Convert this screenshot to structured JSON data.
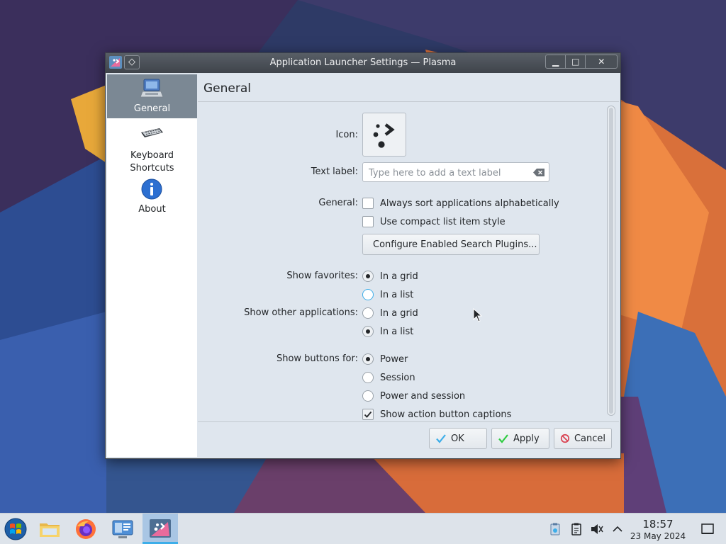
{
  "window": {
    "title": "Application Launcher Settings — Plasma",
    "pin_glyph": "◇",
    "minimize_glyph": "▁",
    "maximize_glyph": "□",
    "close_glyph": "✕"
  },
  "sidebar": {
    "items": [
      {
        "label": "General",
        "icon": "general-settings-icon",
        "active": true
      },
      {
        "label": "Keyboard\nShortcuts",
        "label_line1": "Keyboard",
        "label_line2": "Shortcuts",
        "icon": "keyboard-icon",
        "active": false
      },
      {
        "label": "About",
        "icon": "info-icon",
        "active": false
      }
    ]
  },
  "page": {
    "title": "General",
    "icon_label": "Icon:",
    "text_label": {
      "label": "Text label:",
      "value": "",
      "placeholder": "Type here to add a text label"
    },
    "general_label": "General:",
    "always_sort": {
      "label": "Always sort applications alphabetically",
      "checked": false
    },
    "compact_list": {
      "label": "Use compact list item style",
      "checked": false
    },
    "configure_plugins_label": "Configure Enabled Search Plugins...",
    "show_favorites": {
      "label": "Show favorites:",
      "options": [
        "In a grid",
        "In a list"
      ],
      "selected": "In a grid"
    },
    "show_other_apps": {
      "label": "Show other applications:",
      "options": [
        "In a grid",
        "In a list"
      ],
      "selected": "In a list"
    },
    "show_buttons": {
      "label": "Show buttons for:",
      "options": [
        "Power",
        "Session",
        "Power and session"
      ],
      "selected": "Power"
    },
    "show_captions": {
      "label": "Show action button captions",
      "checked": true
    }
  },
  "dialog_buttons": {
    "ok": "OK",
    "apply": "Apply",
    "cancel": "Cancel"
  },
  "taskbar": {
    "apps": [
      "start-menu-icon",
      "file-manager-icon",
      "firefox-icon",
      "system-settings-icon",
      "plasma-launcher-icon"
    ],
    "clock_time": "18:57",
    "clock_date": "23 May 2024"
  },
  "colors": {
    "accent": "#3daee9",
    "window_bg": "#dfe6ee",
    "sidebar_active": "#7b8894",
    "ok_check": "#3daee9",
    "apply_check": "#2ecc40",
    "cancel_icon": "#da4453"
  }
}
